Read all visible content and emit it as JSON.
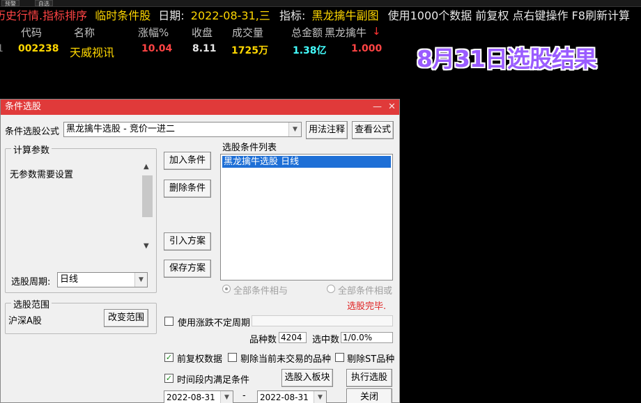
{
  "top_strip": {
    "tab1": "预警",
    "tab2": "自选"
  },
  "info_bar": {
    "part1": "历史行情.指标排序",
    "part2": "临时条件股",
    "date_label": "日期:",
    "date_value": "2022-08-31,三",
    "indicator_label": "指标:",
    "indicator_value": "黑龙擒牛副图",
    "tail": "使用1000个数据 前复权 点右键操作 F8刷新计算"
  },
  "table": {
    "headers": [
      "代码",
      "名称",
      "涨幅%",
      "收盘",
      "成交量",
      "总金额",
      "黑龙擒牛",
      "↓"
    ],
    "row": {
      "marker": "1",
      "code": "002238",
      "name": "天威视讯",
      "change": "10.04",
      "close": "8.11",
      "volume": "1725万",
      "amount": "1.38亿",
      "signal": "1.000"
    }
  },
  "overlay_title": "8月31日选股结果",
  "dialog": {
    "title": "条件选股",
    "min_icon": "—",
    "close_icon": "✕",
    "formula_label": "条件选股公式",
    "formula_value": "黑龙擒牛选股 - 竞价一进二",
    "usage_btn": "用法注释",
    "view_formula_btn": "查看公式",
    "params_group": "计算参数",
    "params_text": "无参数需要设置",
    "period_label": "选股周期:",
    "period_value": "日线",
    "range_group": "选股范围",
    "range_value": "沪深A股",
    "change_range_btn": "改变范围",
    "add_cond_btn": "加入条件",
    "del_cond_btn": "删除条件",
    "import_btn": "引入方案",
    "save_btn": "保存方案",
    "cond_list_label": "选股条件列表",
    "cond_items": [
      "黑龙擒牛选股  日线"
    ],
    "radio_and": "全部条件相与",
    "radio_or": "全部条件相或",
    "status": "选股完毕.",
    "use_uncertain_period": "使用涨跌不定周期",
    "count_label": "品种数",
    "count_value": "4204",
    "selected_label": "选中数",
    "selected_value": "1/0.0%",
    "pre_adjust": "前复权数据",
    "exclude_not_traded": "剔除当前未交易的品种",
    "exclude_st": "剔除ST品种",
    "time_range_cond": "时间段内满足条件",
    "to_block_btn": "选股入板块",
    "execute_btn": "执行选股",
    "date_from": "2022-08-31",
    "date_sep": "-",
    "date_to": "2022-08-31",
    "close_btn": "关闭",
    "checks": {
      "pre_adjust": true,
      "exclude_not_traded": false,
      "exclude_st": false,
      "time_range": true,
      "uncertain": false
    }
  },
  "colors": {
    "title_bar": "#e03a3a",
    "selection": "#1e6fd6",
    "overlay_title": "#9a5cff",
    "status": "#e02020"
  }
}
